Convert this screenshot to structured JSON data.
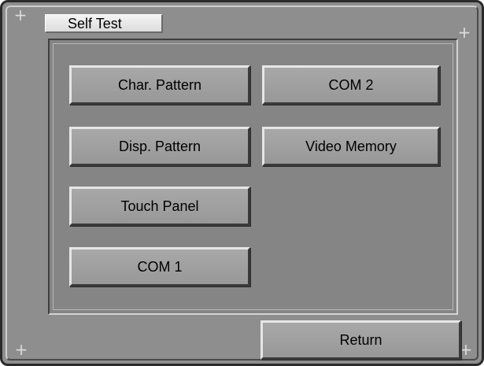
{
  "window": {
    "title": "Self Test"
  },
  "corner_icon": "+",
  "buttons": {
    "char_pattern": "Char. Pattern",
    "com2": "COM 2",
    "disp_pattern": "Disp. Pattern",
    "video_memory": "Video Memory",
    "touch_panel": "Touch Panel",
    "com1": "COM 1",
    "return": "Return"
  },
  "icons": {
    "corner_screws": "plus-screw-icon"
  },
  "colors": {
    "window_bg": "#8e8e8e",
    "panel_bg": "#858585",
    "button_face": "#a0a0a0",
    "title_tab_bg": "#e8e8e8",
    "text": "#000000"
  }
}
